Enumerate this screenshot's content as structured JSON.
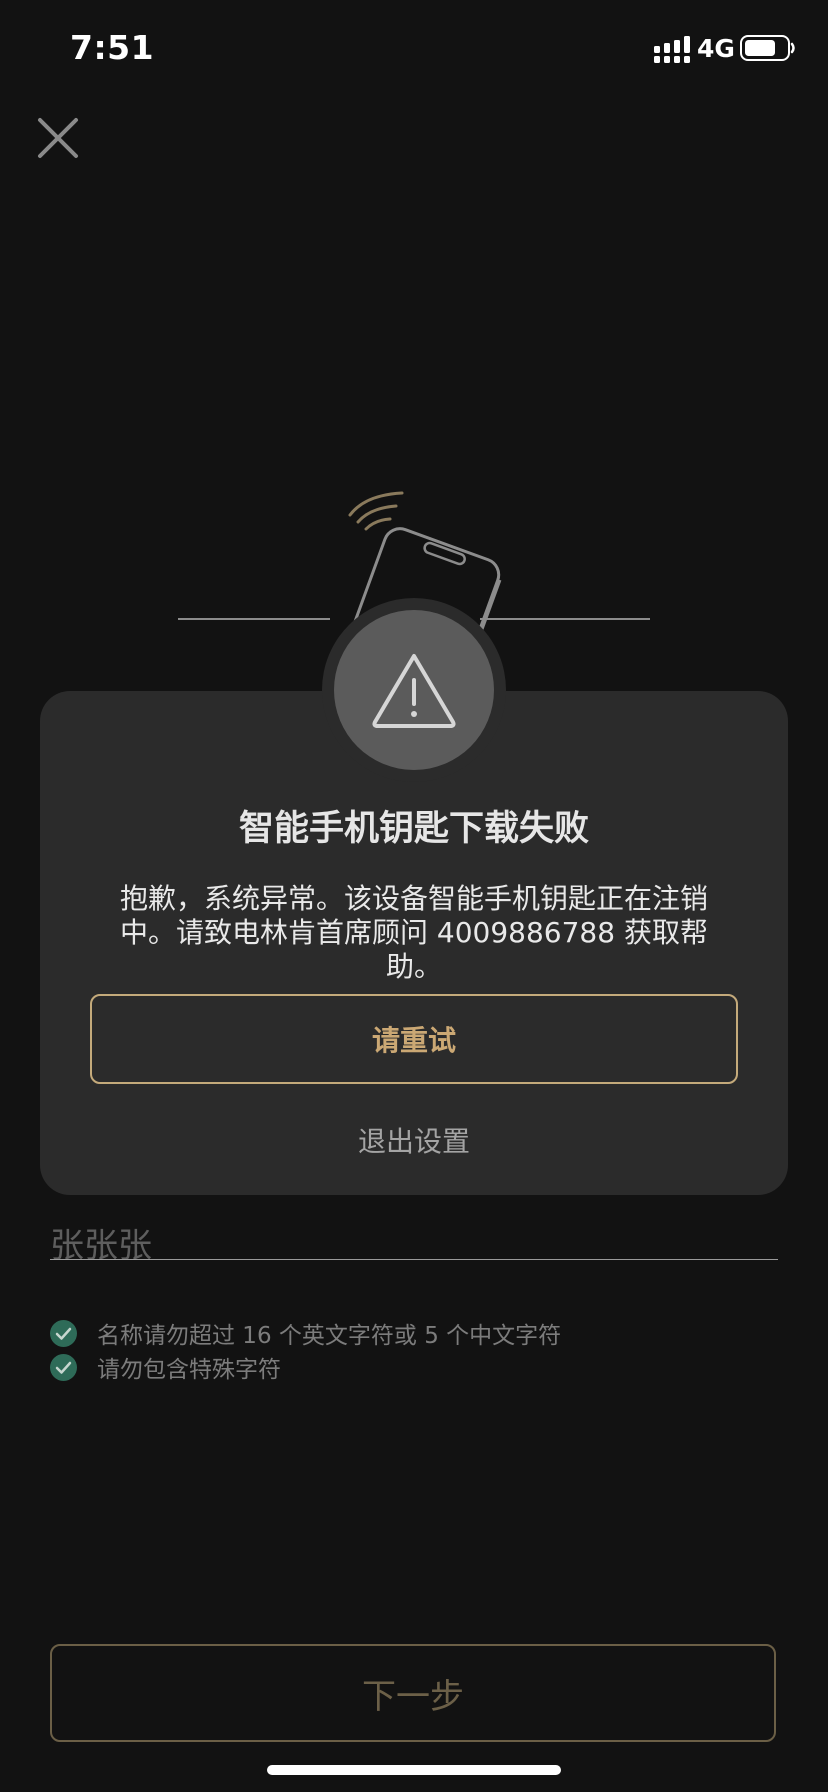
{
  "status_bar": {
    "time": "7:51",
    "network": "4G",
    "signal_icon": "signal-bars-icon",
    "battery_icon": "battery-icon"
  },
  "header": {
    "close_icon": "close-icon"
  },
  "illustration": {
    "icon": "phone-nfc-icon"
  },
  "dialog": {
    "icon": "warning-triangle-icon",
    "title": "智能手机钥匙下载失败",
    "message": "抱歉，系统异常。该设备智能手机钥匙正在注销中。请致电林肯首席顾问 4009886788 获取帮助。",
    "retry_label": "请重试",
    "exit_label": "退出设置"
  },
  "form": {
    "name_value": "张张张",
    "rules": [
      {
        "text": "名称请勿超过 16 个英文字符或 5 个中文字符",
        "icon": "check-circle-icon"
      },
      {
        "text": "请勿包含特殊字符",
        "icon": "check-circle-icon"
      }
    ],
    "next_label": "下一步"
  },
  "colors": {
    "background": "#121212",
    "dialog_bg": "#2b2b2b",
    "accent_gold": "#c4aa7b",
    "check_green": "#2e6b58"
  }
}
